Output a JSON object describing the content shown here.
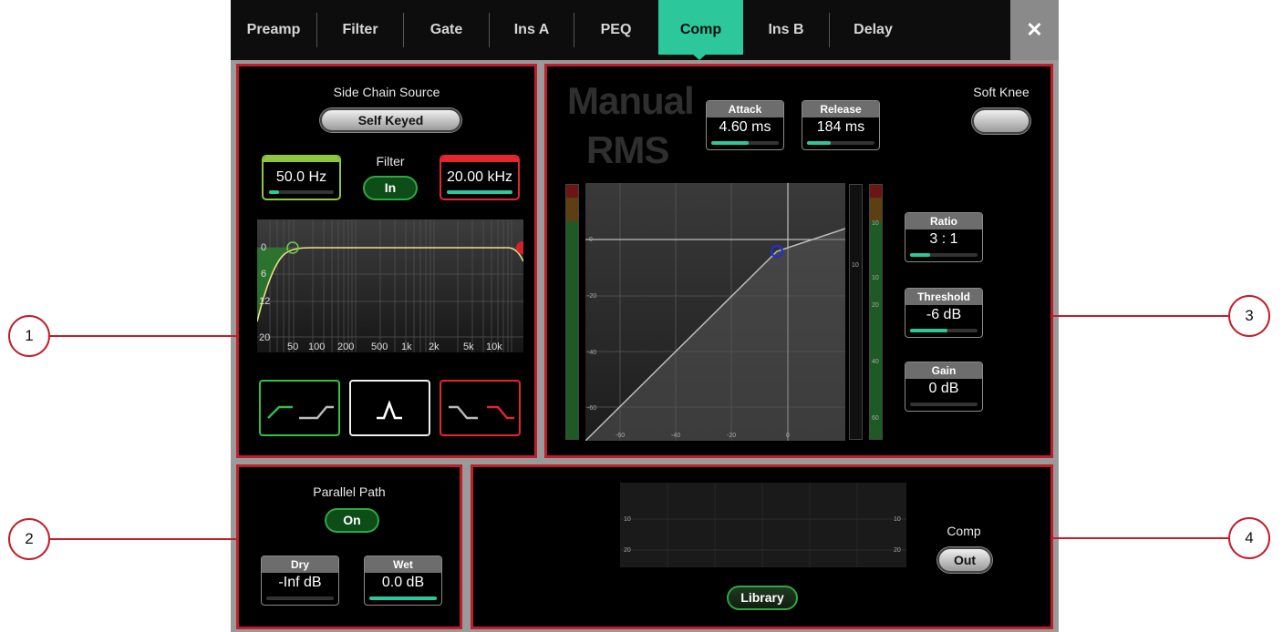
{
  "tabs": [
    {
      "label": "Preamp"
    },
    {
      "label": "Filter"
    },
    {
      "label": "Gate"
    },
    {
      "label": "Ins A"
    },
    {
      "label": "PEQ"
    },
    {
      "label": "Comp"
    },
    {
      "label": "Ins B"
    },
    {
      "label": "Delay"
    }
  ],
  "active_tab": "Comp",
  "close_glyph": "✕",
  "callouts": [
    "1",
    "2",
    "3",
    "4"
  ],
  "sidechain": {
    "title": "Side Chain Source",
    "source": "Self Keyed",
    "hpf_freq": "50.0 Hz",
    "hpf_level": 0.15,
    "hpf_color": "#8dc641",
    "lpf_freq": "20.00 kHz",
    "lpf_level": 1.0,
    "lpf_color": "#e5262f",
    "filter_label": "Filter",
    "filter_state": "In",
    "graph_y_ticks": [
      "0",
      "6",
      "12",
      "20"
    ],
    "graph_x_ticks": [
      "50",
      "100",
      "200",
      "500",
      "1k",
      "2k",
      "5k",
      "10k"
    ],
    "filter_types": [
      "hpf-shelf",
      "bandpass",
      "lpf-shelf"
    ]
  },
  "parallel": {
    "title": "Parallel Path",
    "state": "On",
    "dry_label": "Dry",
    "dry_value": "-Inf dB",
    "dry_level": 0.0,
    "wet_label": "Wet",
    "wet_value": "0.0 dB",
    "wet_level": 1.0
  },
  "comp": {
    "mode_line1": "Manual",
    "mode_line2": "RMS",
    "attack_label": "Attack",
    "attack_value": "4.60 ms",
    "attack_level": 0.55,
    "release_label": "Release",
    "release_value": "184 ms",
    "release_level": 0.35,
    "soft_knee_label": "Soft Knee",
    "ratio_label": "Ratio",
    "ratio_value": "3 : 1",
    "ratio_level": 0.3,
    "threshold_label": "Threshold",
    "threshold_value": "-6 dB",
    "threshold_level": 0.55,
    "gain_label": "Gain",
    "gain_value": "0 dB",
    "gain_level": 0.0,
    "graph_y_ticks": [
      "0",
      "-20",
      "-40",
      "-60"
    ],
    "graph_x_ticks": [
      "-60",
      "-40",
      "-20",
      "0"
    ],
    "gr_meter_ticks": [
      "10"
    ],
    "out_meter_ticks": [
      "10",
      "10",
      "20",
      "40",
      "60"
    ]
  },
  "library": {
    "comp_label": "Comp",
    "comp_state": "Out",
    "library_button": "Library",
    "history_ticks": [
      "10",
      "20"
    ]
  }
}
